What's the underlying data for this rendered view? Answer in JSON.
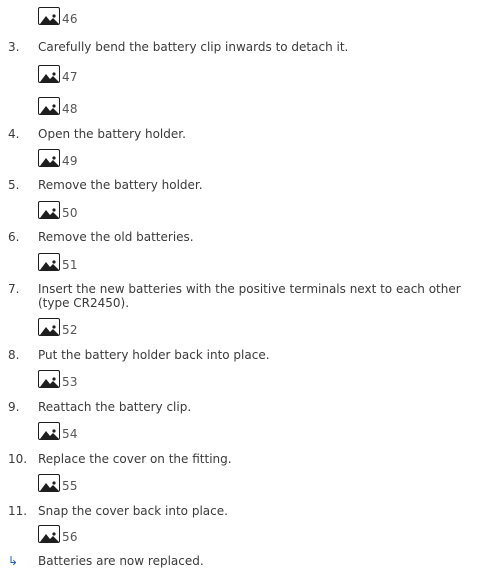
{
  "images": [
    {
      "number": "46"
    },
    {
      "number": "47"
    },
    {
      "number": "48"
    },
    {
      "number": "49"
    },
    {
      "number": "50"
    },
    {
      "number": "51"
    },
    {
      "number": "52"
    },
    {
      "number": "53"
    },
    {
      "number": "54"
    },
    {
      "number": "55"
    },
    {
      "number": "56"
    }
  ],
  "steps": [
    {
      "number": "3.",
      "text": "Carefully bend the battery clip inwards to detach it."
    },
    {
      "number": "4.",
      "text": "Open the battery holder."
    },
    {
      "number": "5.",
      "text": "Remove the battery holder."
    },
    {
      "number": "6.",
      "text": "Remove the old batteries."
    },
    {
      "number": "7.",
      "text": "Insert the new batteries with the positive terminals next to each other (type CR2450)."
    },
    {
      "number": "8.",
      "text": "Put the battery holder back into place."
    },
    {
      "number": "9.",
      "text": "Reattach the battery clip."
    },
    {
      "number": "10.",
      "text": "Replace the cover on the fitting."
    },
    {
      "number": "11.",
      "text": "Snap the cover back into place."
    }
  ],
  "result": {
    "symbol": "↳",
    "text": "Batteries are now replaced."
  },
  "colors": {
    "result_arrow": "#1a5fb4",
    "text": "#3a3a3a",
    "icon_border": "#1e1e1e"
  },
  "icon": "image-placeholder-icon"
}
